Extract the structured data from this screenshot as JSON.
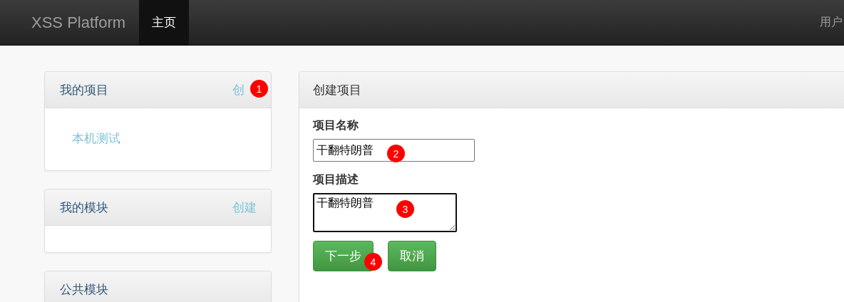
{
  "navbar": {
    "brand": "XSS Platform",
    "items": [
      {
        "label": "主页",
        "selected": true
      }
    ],
    "user": "用户"
  },
  "sidebar": [
    {
      "title": "我的项目",
      "action": "创",
      "body": true,
      "items": [
        "本机测试"
      ]
    },
    {
      "title": "我的模块",
      "action": "创建",
      "body": true
    },
    {
      "title": "公共模块"
    }
  ],
  "form": {
    "title": "创建项目",
    "name_label": "项目名称",
    "name_value": "干翻特朗普",
    "description_label": "项目描述",
    "description_value": "干翻特朗普",
    "buttons": [
      "下一步",
      "取消"
    ]
  },
  "annotations": [
    "1",
    "2",
    "3",
    "4"
  ]
}
